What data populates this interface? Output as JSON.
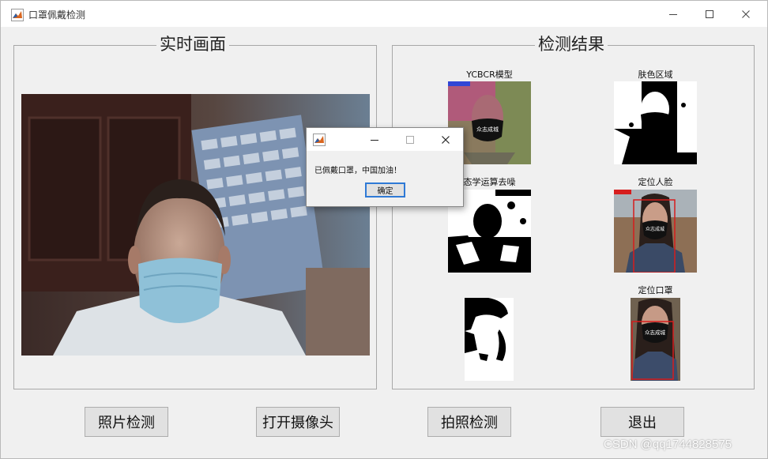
{
  "window": {
    "title": "口罩佩戴检测"
  },
  "panels": {
    "live": {
      "title": "实时画面"
    },
    "result": {
      "title": "检测结果",
      "thumbnails": [
        {
          "label": "YCBCR模型"
        },
        {
          "label": "肤色区域"
        },
        {
          "label": "态学运算去噪"
        },
        {
          "label": "定位人脸"
        },
        {
          "label": ""
        },
        {
          "label": "定位口罩"
        }
      ],
      "mask_text": "众志成城"
    }
  },
  "buttons": {
    "photo": "照片检测",
    "camera": "打开摄像头",
    "snap": "拍照检测",
    "exit": "退出"
  },
  "dialog": {
    "message": "已佩戴口罩，中国加油！",
    "ok_label": "确定"
  },
  "watermark": "CSDN @qq1744828575",
  "icons": {
    "app": "matlab-icon",
    "minimize": "minimize-icon",
    "maximize": "maximize-icon",
    "close": "close-icon"
  }
}
